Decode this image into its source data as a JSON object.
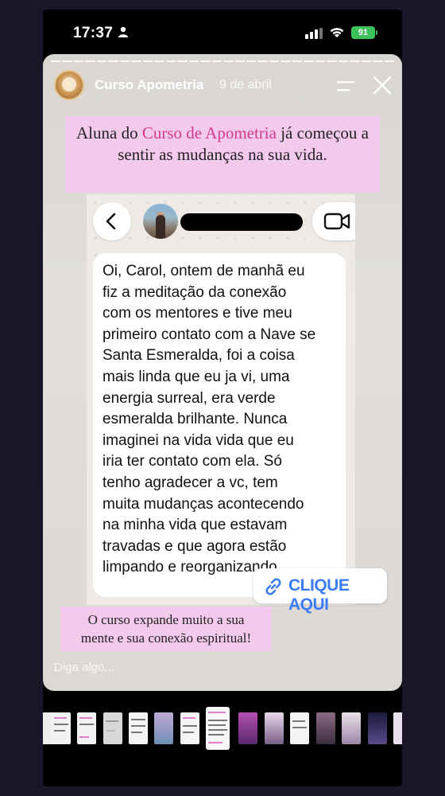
{
  "status_bar": {
    "time": "17:37",
    "battery": "91"
  },
  "story": {
    "account_name": "Curso Apometria",
    "date": "9 de abril",
    "caption_top": {
      "before": "Aluna do ",
      "highlight": "Curso de Apometria",
      "after": " já começou a sentir as mudanças na sua vida."
    },
    "message": "Oi, Carol, ontem de manhã eu\nfiz  a meditação da conexão\ncom os mentores e tive meu\nprimeiro contato com a Nave se\nSanta Esmeralda, foi a coisa\nmais linda que eu ja vi, uma\nenergia surreal, era verde\nesmeralda brilhante. Nunca\nimaginei na vida vida que eu\niria ter contato com ela. Só\ntenho agradecer a vc, tem\nmuita mudanças acontecendo\nna minha vida que estavam\ntravadas e que agora estão\nlimpando e reorganizando.",
    "link_label": "CLIQUE AQUI",
    "caption_bottom": "O curso expande muito a sua\nmente e sua conexão espiritual!",
    "reply_placeholder": "Diga algo..."
  },
  "colors": {
    "caption_bg": "#f3c9ec",
    "highlight": "#d23b8f",
    "link": "#3b7cf6",
    "battery": "#3dc25a"
  },
  "icons": [
    "person-icon",
    "signal-icon",
    "wifi-icon",
    "menu-icon",
    "close-icon",
    "back-chevron-icon",
    "video-call-icon",
    "link-icon"
  ]
}
